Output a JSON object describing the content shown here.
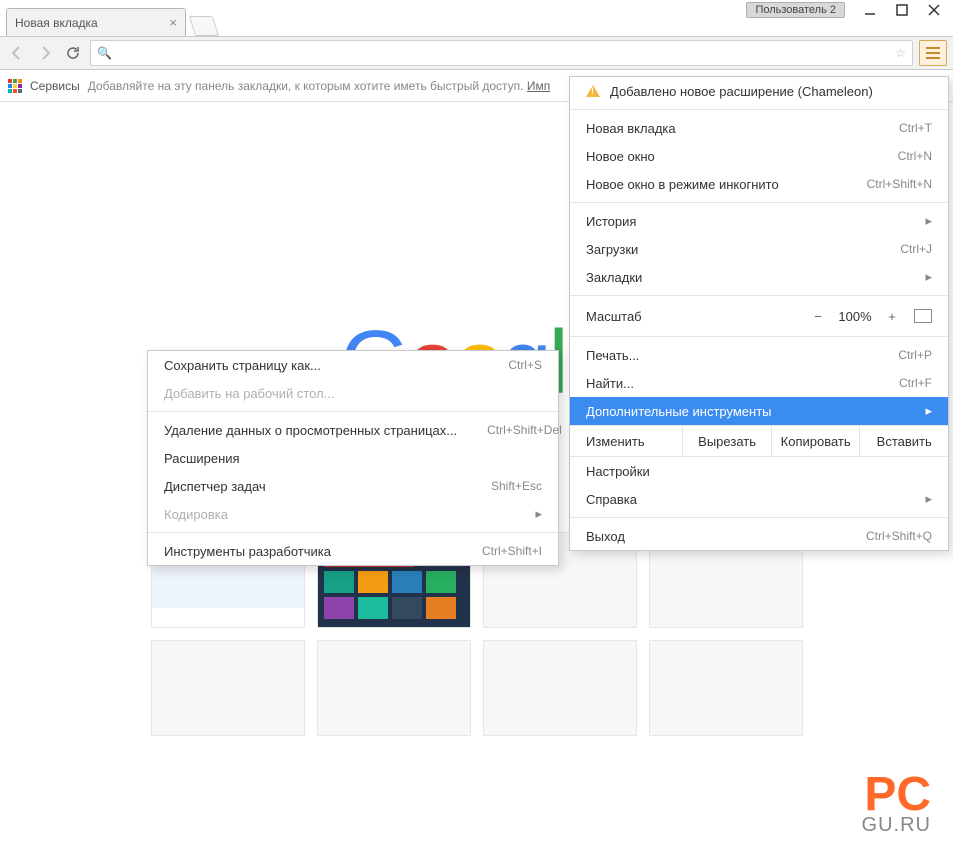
{
  "titlebar": {
    "tab_title": "Новая вкладка",
    "user_badge": "Пользователь 2"
  },
  "bookmark_bar": {
    "apps_label": "Сервисы",
    "hint": "Добавляйте на эту панель закладки, к которым хотите иметь быстрый доступ.",
    "import_link": "Имп"
  },
  "main_menu": {
    "extension_notice": "Добавлено новое расширение (Chameleon)",
    "new_tab": "Новая вкладка",
    "new_tab_sc": "Ctrl+T",
    "new_window": "Новое окно",
    "new_window_sc": "Ctrl+N",
    "incognito": "Новое окно в режиме инкогнито",
    "incognito_sc": "Ctrl+Shift+N",
    "history": "История",
    "downloads": "Загрузки",
    "downloads_sc": "Ctrl+J",
    "bookmarks": "Закладки",
    "zoom": "Масштаб",
    "zoom_value": "100%",
    "print": "Печать...",
    "print_sc": "Ctrl+P",
    "find": "Найти...",
    "find_sc": "Ctrl+F",
    "more_tools": "Дополнительные инструменты",
    "edit": "Изменить",
    "cut": "Вырезать",
    "copy": "Копировать",
    "paste": "Вставить",
    "settings": "Настройки",
    "help": "Справка",
    "exit": "Выход",
    "exit_sc": "Ctrl+Shift+Q"
  },
  "sub_menu": {
    "save_page": "Сохранить страницу как...",
    "save_page_sc": "Ctrl+S",
    "add_desktop": "Добавить на рабочий стол...",
    "clear_data": "Удаление данных о просмотренных страницах...",
    "clear_data_sc": "Ctrl+Shift+Del",
    "extensions": "Расширения",
    "task_mgr": "Диспетчер задач",
    "task_mgr_sc": "Shift+Esc",
    "encoding": "Кодировка",
    "dev_tools": "Инструменты разработчика",
    "dev_tools_sc": "Ctrl+Shift+I"
  },
  "watermark": {
    "line1": "PC",
    "line2": "GU.RU"
  }
}
